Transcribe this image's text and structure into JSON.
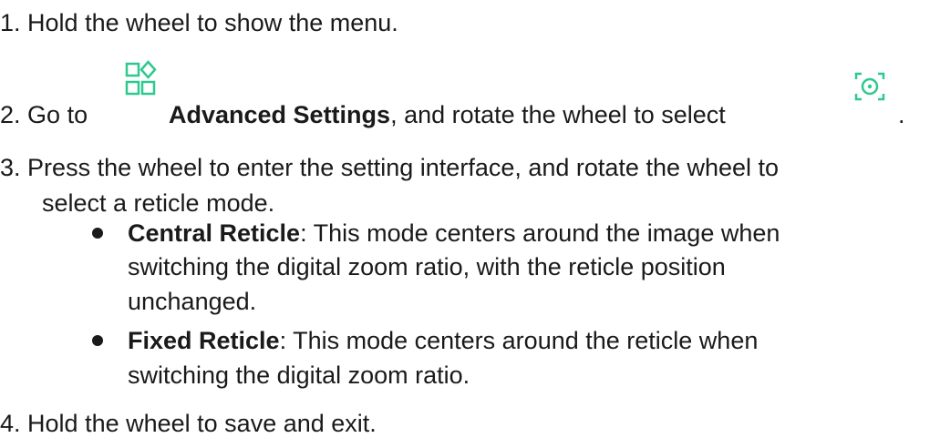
{
  "colors": {
    "text": "#1a1a1a",
    "icon_accent": "#2ec98e"
  },
  "steps": [
    {
      "number": "1.",
      "text": "Hold the wheel to show the menu."
    },
    {
      "number": "2.",
      "before_icon": "Go to",
      "icon": "advanced-settings-icon",
      "bold": "Advanced Settings",
      "after": ", and rotate the wheel to select",
      "icon2": "reticle-icon",
      "end": "."
    },
    {
      "number": "3.",
      "line1": "Press the wheel to enter the setting interface, and rotate the wheel to",
      "line2": "select a reticle mode.",
      "bullets": [
        {
          "term": "Central Reticle",
          "line1": ": This mode centers around the image when",
          "line2": "switching the digital zoom ratio, with the reticle position",
          "line3": "unchanged."
        },
        {
          "term": "Fixed Reticle",
          "line1": ": This mode centers around the reticle when",
          "line2": "switching the digital zoom ratio."
        }
      ]
    },
    {
      "number": "4.",
      "text": "Hold the wheel to save and exit."
    }
  ]
}
